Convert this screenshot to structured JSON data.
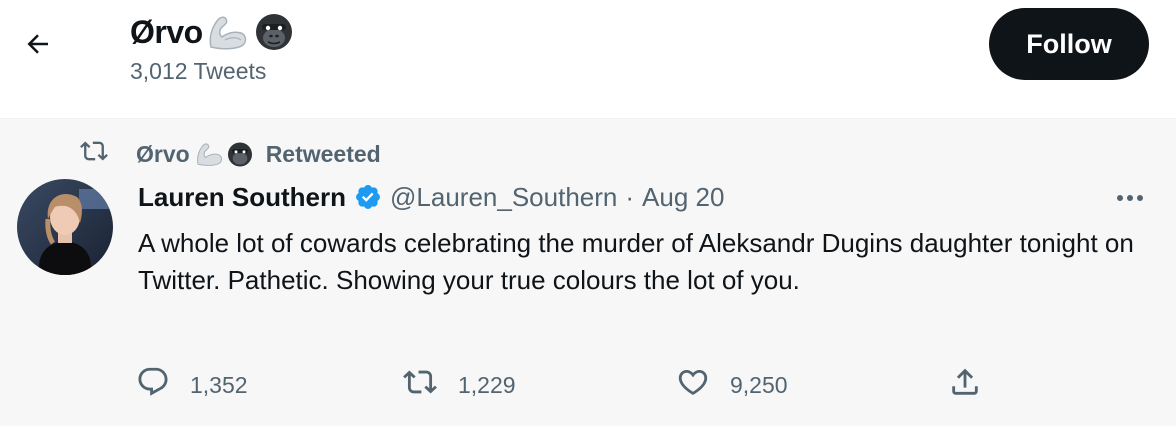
{
  "header": {
    "back_icon": "arrow-left-icon",
    "profile_name": "Ørvo",
    "name_emojis": [
      "flexed-biceps-icon",
      "gorilla-icon"
    ],
    "tweet_count": "3,012 Tweets",
    "follow_label": "Follow"
  },
  "tweet": {
    "retweet": {
      "icon": "retweet-icon",
      "retweeter_name": "Ørvo",
      "retweeter_emojis": [
        "flexed-biceps-icon",
        "gorilla-icon"
      ],
      "label": "Retweeted"
    },
    "author": {
      "name": "Lauren Southern",
      "verified": true,
      "handle": "@Lauren_Southern",
      "separator": "·",
      "date": "Aug 20"
    },
    "more_icon": "more-horizontal-icon",
    "text": "A whole lot of cowards celebrating the murder of Aleksandr Dugins daughter tonight on Twitter. Pathetic. Showing your true colours the lot of you.",
    "actions": [
      {
        "name": "reply",
        "icon": "reply-icon",
        "count": "1,352"
      },
      {
        "name": "retweet",
        "icon": "retweet-icon",
        "count": "1,229"
      },
      {
        "name": "like",
        "icon": "heart-icon",
        "count": "9,250"
      },
      {
        "name": "share",
        "icon": "share-icon",
        "count": ""
      }
    ]
  },
  "colors": {
    "text_primary": "#0f1419",
    "text_secondary": "#536471",
    "verified_blue": "#1d9bf0",
    "follow_button_bg": "#0f1419",
    "tweet_bg": "#f7f7f7"
  }
}
